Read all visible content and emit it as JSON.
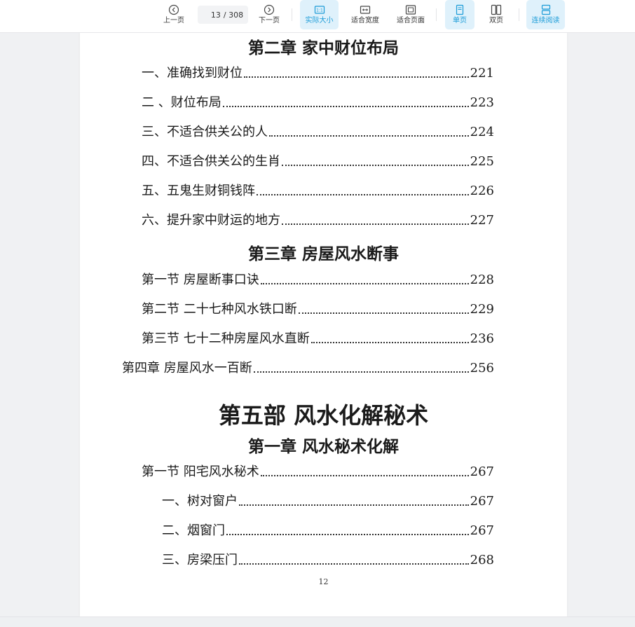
{
  "toolbar": {
    "prev_label": "上一页",
    "next_label": "下一页",
    "page_current": "13",
    "page_total": "/ 308",
    "actual_size_label": "实际大小",
    "fit_width_label": "适合宽度",
    "fit_page_label": "适合页面",
    "single_page_label": "单页",
    "double_page_label": "双页",
    "continuous_label": "连续阅读",
    "accent_color": "#1a9bd7",
    "active_bg": "#dff1fb"
  },
  "document": {
    "chapter2_title": "第二章  家中财位布局",
    "chapter2_items": [
      {
        "title": "一、准确找到财位",
        "page": "221"
      },
      {
        "title": "二 、财位布局",
        "page": "223"
      },
      {
        "title": "三、不适合供关公的人",
        "page": "224"
      },
      {
        "title": "四、不适合供关公的生肖",
        "page": "225"
      },
      {
        "title": "五、五鬼生财铜钱阵",
        "page": "226"
      },
      {
        "title": "六、提升家中财运的地方",
        "page": "227"
      }
    ],
    "chapter3_title": "第三章  房屋风水断事",
    "chapter3_items": [
      {
        "title": "第一节  房屋断事口诀",
        "page": "228"
      },
      {
        "title": "第二节  二十七种风水铁口断",
        "page": "229"
      },
      {
        "title": "第三节  七十二种房屋风水直断",
        "page": "236"
      }
    ],
    "chapter4_item": {
      "title": "第四章  房屋风水一百断",
      "page": "256"
    },
    "part5_title": "第五部  风水化解秘术",
    "part5_chapter1_title": "第一章  风水秘术化解",
    "part5_items": [
      {
        "title": "第一节  阳宅风水秘术",
        "page": "267"
      },
      {
        "title": "一、树对窗户",
        "page": "267"
      },
      {
        "title": "二、烟窗门",
        "page": "267"
      },
      {
        "title": "三、房梁压门",
        "page": "268"
      }
    ],
    "page_number": "12"
  }
}
